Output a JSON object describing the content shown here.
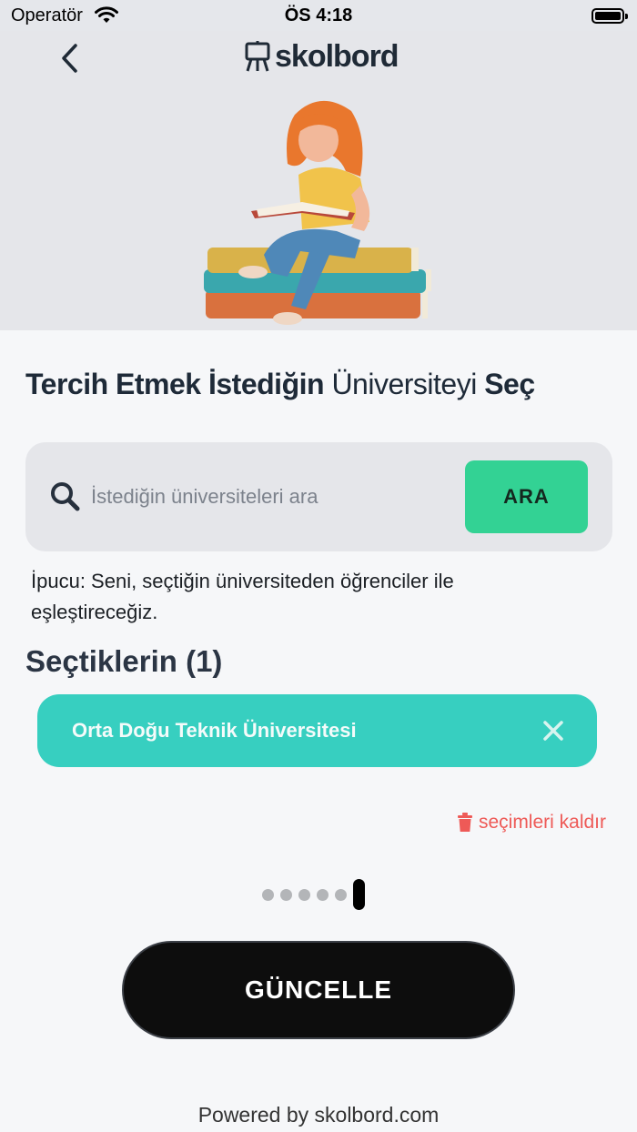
{
  "status_bar": {
    "carrier": "Operatör",
    "time": "ÖS 4:18"
  },
  "header": {
    "back_icon": "chevron-left-icon",
    "logo_icon": "easel-icon",
    "logo_text": "skolbord"
  },
  "headline": {
    "part1_bold": "Tercih Etmek İstediğin",
    "part2": " Üniversiteyi ",
    "part3_bold": "Seç"
  },
  "search": {
    "icon": "search-icon",
    "placeholder": "İstediğin üniversiteleri ara",
    "value": "",
    "button_label": "ARA"
  },
  "hint": "İpucu: Seni, seçtiğin üniversiteden öğrenciler ile eşleştireceğiz.",
  "selections": {
    "title": "Seçtiklerin (1)",
    "items": [
      {
        "label": "Orta Doğu Teknik Üniversitesi",
        "remove_icon": "close-icon"
      }
    ],
    "remove_all_icon": "trash-icon",
    "remove_all_label": "seçimleri kaldır"
  },
  "pagination": {
    "total_steps": 6,
    "active_step": 6
  },
  "primary_button": {
    "label": "GÜNCELLE"
  },
  "footer": {
    "powered_by": "Powered by skolbord.com"
  },
  "colors": {
    "accent_green": "#33d294",
    "chip_teal": "#37cfc0",
    "danger_red": "#ee5a57",
    "button_dark": "#0d0d0d",
    "header_gray": "#e5e6ea"
  }
}
